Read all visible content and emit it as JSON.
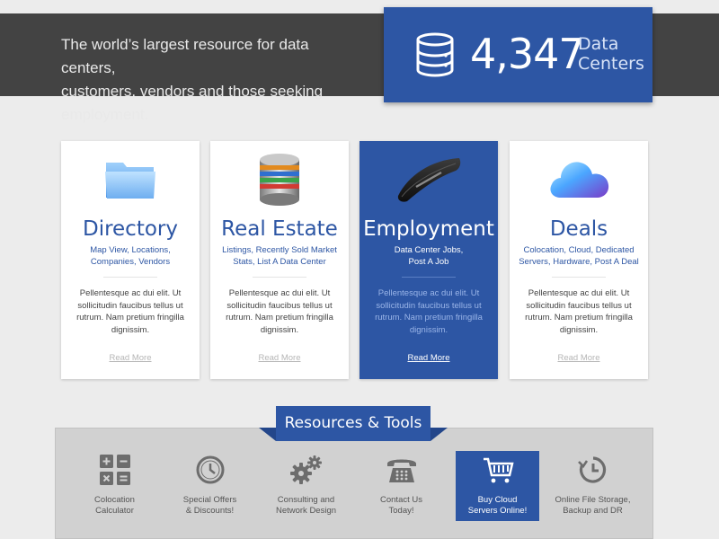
{
  "hero": {
    "tagline_line1": "The world’s largest resource for data centers,",
    "tagline_line2": "customers, vendors and those seeking employment.",
    "stat_number": "4,347",
    "stat_label_line1": "Data",
    "stat_label_line2": "Centers",
    "stat_icon": "database-icon"
  },
  "cards": [
    {
      "title": "Directory",
      "sub_line1": "Map View, Locations,",
      "sub_line2": "Companies, Vendors",
      "text": "Pellentesque ac dui elit. Ut sollicitudin faucibus tellus ut rutrum. Nam pretium fringilla dignissim.",
      "link": "Read More",
      "icon": "folder-icon",
      "active": false
    },
    {
      "title": "Real Estate",
      "sub_line1": "Listings, Recently Sold Market",
      "sub_line2": "Stats, List A Data Center",
      "text": "Pellentesque ac dui elit. Ut sollicitudin faucibus tellus ut rutrum. Nam pretium fringilla dignissim.",
      "link": "Read More",
      "icon": "server-stack-icon",
      "active": false
    },
    {
      "title": "Employment",
      "sub_line1": "Data Center Jobs,",
      "sub_line2": "Post A Job",
      "text": "Pellentesque ac dui elit. Ut sollicitudin faucibus tellus ut rutrum. Nam pretium fringilla dignissim.",
      "link": "Read More",
      "icon": "mouse-icon",
      "active": true
    },
    {
      "title": "Deals",
      "sub_line1": "Colocation, Cloud, Dedicated",
      "sub_line2": "Servers, Hardware, Post A Deal",
      "text": "Pellentesque ac dui elit. Ut sollicitudin faucibus tellus ut rutrum. Nam pretium fringilla dignissim.",
      "link": "Read More",
      "icon": "cloud-icon",
      "active": false
    }
  ],
  "tools": {
    "banner": "Resources & Tools",
    "items": [
      {
        "line1": "Colocation",
        "line2": "Calculator",
        "icon": "calculator-icon",
        "active": false
      },
      {
        "line1": "Special Offers",
        "line2": "& Discounts!",
        "icon": "clock-icon",
        "active": false
      },
      {
        "line1": "Consulting and",
        "line2": "Network Design",
        "icon": "gears-icon",
        "active": false
      },
      {
        "line1": "Contact Us",
        "line2": "Today!",
        "icon": "telephone-icon",
        "active": false
      },
      {
        "line1": "Buy Cloud",
        "line2": "Servers Online!",
        "icon": "shopping-cart-icon",
        "active": true
      },
      {
        "line1": "Online File Storage,",
        "line2": "Backup and DR",
        "icon": "backup-icon",
        "active": false
      }
    ]
  },
  "colors": {
    "brand_blue": "#2d56a4",
    "band_dark": "#434343",
    "page_bg": "#ececec",
    "panel_gray": "#d1d1d1"
  }
}
